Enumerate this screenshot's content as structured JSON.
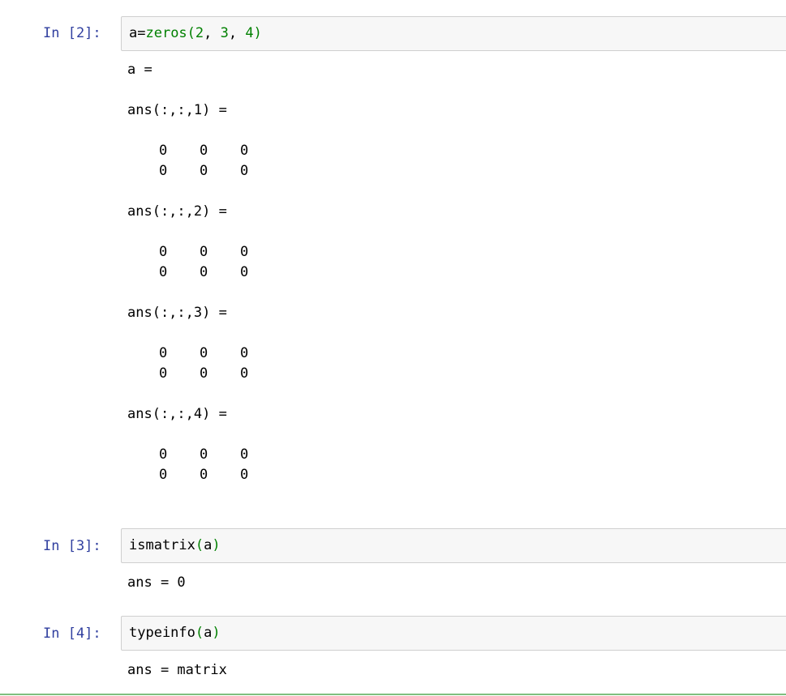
{
  "cells": [
    {
      "prompt": "In [2]:",
      "code": {
        "ident": "a=",
        "func": "zeros",
        "open": "(",
        "n1": "2",
        "sep1": ", ",
        "n2": "3",
        "sep2": ", ",
        "n3": "4",
        "close": ")"
      },
      "output": {
        "header": "a =",
        "slices": [
          {
            "label": "ans(:,:,1) =",
            "rows": [
              [
                "0",
                "0",
                "0"
              ],
              [
                "0",
                "0",
                "0"
              ]
            ]
          },
          {
            "label": "ans(:,:,2) =",
            "rows": [
              [
                "0",
                "0",
                "0"
              ],
              [
                "0",
                "0",
                "0"
              ]
            ]
          },
          {
            "label": "ans(:,:,3) =",
            "rows": [
              [
                "0",
                "0",
                "0"
              ],
              [
                "0",
                "0",
                "0"
              ]
            ]
          },
          {
            "label": "ans(:,:,4) =",
            "rows": [
              [
                "0",
                "0",
                "0"
              ],
              [
                "0",
                "0",
                "0"
              ]
            ]
          }
        ]
      }
    },
    {
      "prompt": "In [3]:",
      "code": {
        "func": "ismatrix",
        "open": "(",
        "arg": "a",
        "close": ")"
      },
      "output": {
        "text": "ans = 0"
      }
    },
    {
      "prompt": "In [4]:",
      "code": {
        "func": "typeinfo",
        "open": "(",
        "arg": "a",
        "close": ")"
      },
      "output": {
        "text": "ans = matrix"
      }
    }
  ]
}
